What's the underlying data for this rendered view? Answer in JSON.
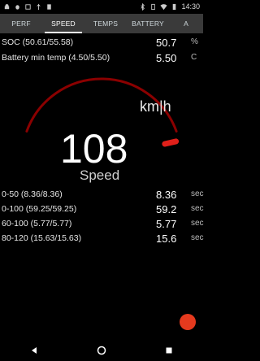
{
  "status_bar": {
    "time": "14:30",
    "icons_left": [
      "android-icon",
      "bug-icon",
      "debug-icon",
      "usb-icon",
      "sd-icon"
    ],
    "icons_right": [
      "bluetooth-icon",
      "vibrate-icon",
      "wifi-icon",
      "battery-icon"
    ]
  },
  "tabs": [
    {
      "label": "PERF",
      "active": false
    },
    {
      "label": "SPEED",
      "active": true
    },
    {
      "label": "TEMPS",
      "active": false
    },
    {
      "label": "BATTERY",
      "active": false
    },
    {
      "label": "A",
      "active": false
    }
  ],
  "top_metrics": [
    {
      "label": "SOC (50.61/55.58)",
      "value": "50.7",
      "unit": "%"
    },
    {
      "label": "Battery min temp (4.50/5.50)",
      "value": "5.50",
      "unit": "C"
    }
  ],
  "gauge": {
    "speed": "108",
    "speed_label": "Speed",
    "unit": "km|h",
    "level_fraction": 0.72,
    "arc_color": "#8b0000",
    "needle_color": "#e0201a"
  },
  "bottom_metrics": [
    {
      "label": "0-50 (8.36/8.36)",
      "value": "8.36",
      "unit": "sec"
    },
    {
      "label": "0-100 (59.25/59.25)",
      "value": "59.2",
      "unit": "sec"
    },
    {
      "label": "60-100 (5.77/5.77)",
      "value": "5.77",
      "unit": "sec"
    },
    {
      "label": "80-120 (15.63/15.63)",
      "value": "15.6",
      "unit": "sec"
    }
  ],
  "colors": {
    "fab": "#e53a1e",
    "tab_bar": "#3a3a3a"
  }
}
